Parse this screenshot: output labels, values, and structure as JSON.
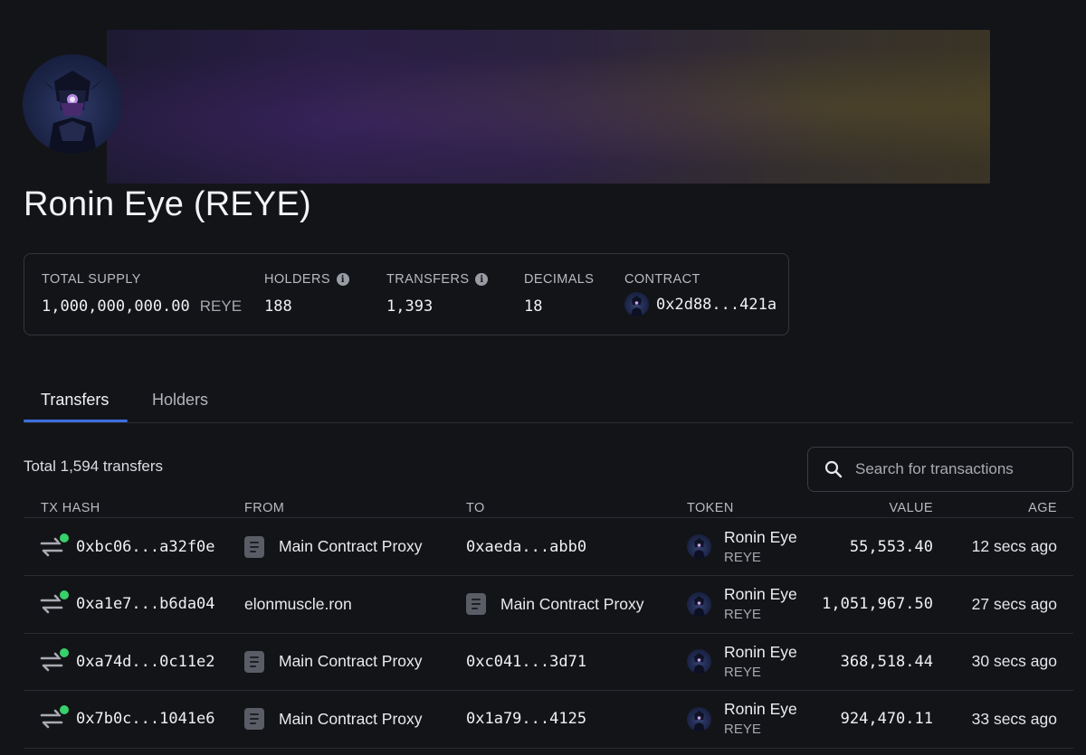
{
  "token": {
    "title": "Ronin Eye (REYE)"
  },
  "stats": {
    "total_supply": {
      "label": "TOTAL SUPPLY",
      "value": "1,000,000,000.00",
      "unit": "REYE"
    },
    "holders": {
      "label": "HOLDERS",
      "value": "188"
    },
    "transfers": {
      "label": "TRANSFERS",
      "value": "1,393"
    },
    "decimals": {
      "label": "DECIMALS",
      "value": "18"
    },
    "contract": {
      "label": "CONTRACT",
      "value": "0x2d88...421a"
    }
  },
  "tabs": [
    {
      "label": "Transfers",
      "active": true
    },
    {
      "label": "Holders",
      "active": false
    }
  ],
  "total_label": "Total 1,594 transfers",
  "search": {
    "placeholder": "Search for transactions"
  },
  "table": {
    "headers": {
      "tx_hash": "TX HASH",
      "from": "FROM",
      "to": "TO",
      "token": "TOKEN",
      "value": "VALUE",
      "age": "AGE"
    },
    "rows": [
      {
        "tx": "0xbc06...a32f0e",
        "from": "Main Contract Proxy",
        "from_is_contract": true,
        "to": "0xaeda...abb0",
        "to_is_contract": false,
        "token_name": "Ronin Eye",
        "token_symbol": "REYE",
        "value": "55,553.40",
        "age": "12 secs ago"
      },
      {
        "tx": "0xa1e7...b6da04",
        "from": "elonmuscle.ron",
        "from_is_contract": false,
        "to": "Main Contract Proxy",
        "to_is_contract": true,
        "token_name": "Ronin Eye",
        "token_symbol": "REYE",
        "value": "1,051,967.50",
        "age": "27 secs ago"
      },
      {
        "tx": "0xa74d...0c11e2",
        "from": "Main Contract Proxy",
        "from_is_contract": true,
        "to": "0xc041...3d71",
        "to_is_contract": false,
        "token_name": "Ronin Eye",
        "token_symbol": "REYE",
        "value": "368,518.44",
        "age": "30 secs ago"
      },
      {
        "tx": "0x7b0c...1041e6",
        "from": "Main Contract Proxy",
        "from_is_contract": true,
        "to": "0x1a79...4125",
        "to_is_contract": false,
        "token_name": "Ronin Eye",
        "token_symbol": "REYE",
        "value": "924,470.11",
        "age": "33 secs ago"
      }
    ]
  },
  "colors": {
    "background": "#131418",
    "accent": "#3b6fe0",
    "status_success": "#37d06a"
  }
}
